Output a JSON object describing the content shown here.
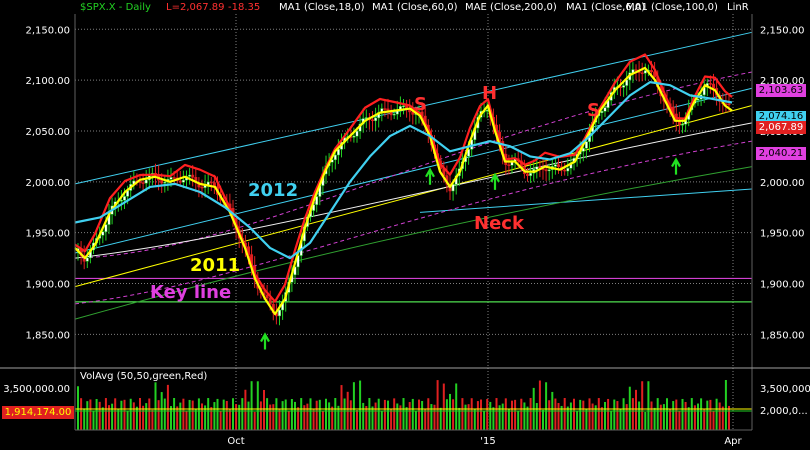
{
  "header": {
    "symbol": "$SPX.X - Daily",
    "last": "L=2,067.89",
    "change": "-18.35",
    "studies": [
      "MA1 (Close,18,0)",
      "MA1 (Close,60,0)",
      "MAE (Close,200,0)",
      "MA1 (Close,6,0)",
      "MA1 (Close,100,0)",
      "LinR"
    ],
    "volume_study": "VolAvg (50,50,green,Red)"
  },
  "colors": {
    "background": "#000000",
    "price_up": "#22d022",
    "price_down": "#e02020",
    "ma18": "#ffff00",
    "ma60": "#40d0f0",
    "ma6": "#ff2020",
    "ma100": "#f0f0f0",
    "ma200": "#30a030",
    "envelope": "#d040d0",
    "channel": "#40d0f0",
    "key_line": "#d040d0",
    "grid": "#7f7f7f"
  },
  "annotations": [
    {
      "text": "2012",
      "color": "#40d0f0"
    },
    {
      "text": "2011",
      "color": "#ffff00"
    },
    {
      "text": "Key line",
      "color": "#e040e0"
    },
    {
      "text": "Neck",
      "color": "#ff3030"
    },
    {
      "text": "S",
      "color": "#ff3030"
    },
    {
      "text": "H",
      "color": "#ff3030"
    },
    {
      "text": "S",
      "color": "#ff3030"
    }
  ],
  "chart_data": {
    "type": "line",
    "title": "$SPX.X - Daily",
    "y_range": [
      1815,
      2165
    ],
    "y_ticks": [
      "2,150.00",
      "2,100.00",
      "2,050.00",
      "2,000.00",
      "1,950.00",
      "1,900.00",
      "1,850.00"
    ],
    "x_ticks": [
      "Oct",
      "'15",
      "Apr"
    ],
    "right_labels": [
      {
        "text": "2,103.63",
        "color": "#e040e0"
      },
      {
        "text": "2,074.16",
        "color": "#40d0f0"
      },
      {
        "text": "2,067.89",
        "color": "#e02020"
      },
      {
        "text": "2,040.21",
        "color": "#e040e0"
      }
    ],
    "key_lines": [
      1905,
      1882
    ],
    "series": [
      {
        "points": [
          [
            75,
            1935
          ],
          [
            85,
            1925
          ],
          [
            95,
            1938
          ],
          [
            110,
            1970
          ],
          [
            125,
            1990
          ],
          [
            140,
            2002
          ],
          [
            155,
            2005
          ],
          [
            170,
            2000
          ],
          [
            185,
            2005
          ],
          [
            200,
            1998
          ],
          [
            215,
            1995
          ],
          [
            230,
            1970
          ],
          [
            245,
            1935
          ],
          [
            255,
            1905
          ],
          [
            265,
            1885
          ],
          [
            275,
            1870
          ],
          [
            285,
            1885
          ],
          [
            295,
            1920
          ],
          [
            305,
            1955
          ],
          [
            315,
            1985
          ],
          [
            325,
            2010
          ],
          [
            335,
            2030
          ],
          [
            350,
            2045
          ],
          [
            365,
            2060
          ],
          [
            380,
            2068
          ],
          [
            395,
            2070
          ],
          [
            410,
            2072
          ],
          [
            420,
            2065
          ],
          [
            430,
            2045
          ],
          [
            440,
            2010
          ],
          [
            450,
            1995
          ],
          [
            460,
            2010
          ],
          [
            470,
            2040
          ],
          [
            480,
            2065
          ],
          [
            488,
            2075
          ],
          [
            495,
            2050
          ],
          [
            505,
            2020
          ],
          [
            515,
            2020
          ],
          [
            525,
            2010
          ],
          [
            535,
            2010
          ],
          [
            545,
            2015
          ],
          [
            560,
            2012
          ],
          [
            575,
            2020
          ],
          [
            585,
            2040
          ],
          [
            600,
            2070
          ],
          [
            615,
            2090
          ],
          [
            630,
            2105
          ],
          [
            645,
            2112
          ],
          [
            655,
            2100
          ],
          [
            665,
            2080
          ],
          [
            675,
            2060
          ],
          [
            685,
            2060
          ],
          [
            695,
            2080
          ],
          [
            705,
            2095
          ],
          [
            715,
            2090
          ],
          [
            725,
            2075
          ],
          [
            732,
            2070
          ]
        ]
      },
      {
        "points": [
          [
            75,
            1960
          ],
          [
            100,
            1965
          ],
          [
            125,
            1980
          ],
          [
            150,
            1995
          ],
          [
            175,
            1998
          ],
          [
            200,
            1990
          ],
          [
            225,
            1975
          ],
          [
            250,
            1955
          ],
          [
            270,
            1935
          ],
          [
            290,
            1925
          ],
          [
            310,
            1940
          ],
          [
            330,
            1970
          ],
          [
            350,
            2000
          ],
          [
            370,
            2025
          ],
          [
            390,
            2045
          ],
          [
            410,
            2055
          ],
          [
            430,
            2045
          ],
          [
            450,
            2030
          ],
          [
            470,
            2035
          ],
          [
            490,
            2040
          ],
          [
            510,
            2035
          ],
          [
            530,
            2025
          ],
          [
            550,
            2022
          ],
          [
            570,
            2028
          ],
          [
            590,
            2045
          ],
          [
            610,
            2065
          ],
          [
            630,
            2085
          ],
          [
            650,
            2098
          ],
          [
            670,
            2095
          ],
          [
            690,
            2085
          ],
          [
            710,
            2082
          ],
          [
            732,
            2078
          ]
        ]
      }
    ],
    "volume": {
      "range_labels": [
        "3,500,000.00",
        "2,000,0..."
      ],
      "volavg_label": "1,914,174.00"
    }
  }
}
